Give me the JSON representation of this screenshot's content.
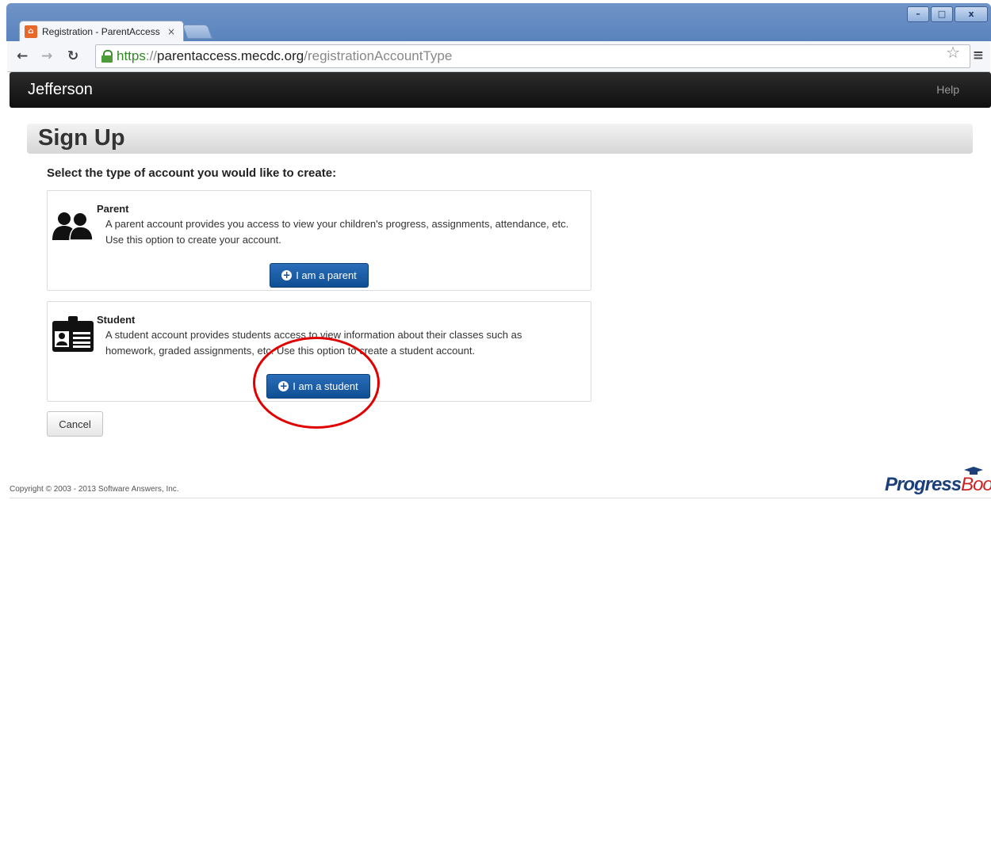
{
  "browser": {
    "tab_title": "Registration - ParentAccess",
    "tab_close": "×",
    "url": {
      "scheme": "https",
      "separator": "://",
      "host": "parentaccess.mecdc.org",
      "path": "/registrationAccountType"
    },
    "window_controls": {
      "minimize": "–",
      "maximize": "□",
      "close": "x"
    }
  },
  "app": {
    "brand": "Jefferson",
    "help": "Help"
  },
  "page": {
    "title": "Sign Up",
    "prompt": "Select the type of account you would like to create:",
    "options": [
      {
        "title": "Parent",
        "description_1": "A parent account provides you access to view your children's progress, assignments, attendance, etc.",
        "description_2": "Use this option to create your account.",
        "button": "I am a parent",
        "icon": "parents-icon"
      },
      {
        "title": "Student",
        "description_1": "A student account provides students access to view information about their classes such as",
        "description_2": "homework, graded assignments, etc. Use this option to create a student account.",
        "button": "I am a student",
        "icon": "student-id-icon"
      }
    ],
    "cancel": "Cancel"
  },
  "footer": {
    "copyright": "Copyright © 2003 - 2013 Software Answers, Inc.",
    "logo_text_1": "Progress",
    "logo_text_2": "Book"
  },
  "colors": {
    "primary_button": "#0f4f94",
    "header_bg": "#111111",
    "annotation": "#e10000",
    "secure_scheme": "#2f8a22"
  }
}
